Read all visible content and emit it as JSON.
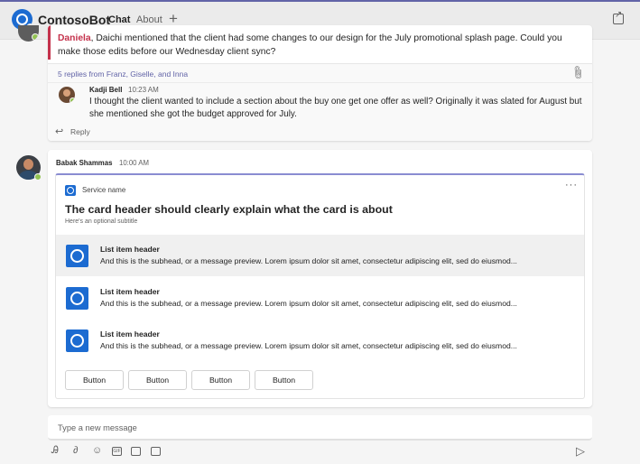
{
  "app": {
    "name": "ContosoBot",
    "tabs": [
      "Chat",
      "About"
    ],
    "active_tab": "Chat",
    "add_tab": "+"
  },
  "previous_message": {
    "mention": "Daniela",
    "text": ", Daichi mentioned that the client had some changes to our design for the July promotional splash page. Could you make those edits before our Wednesday client sync?",
    "replies_summary": "5 replies from Franz, Giselle, and Inna",
    "reply": {
      "author": "Kadji Bell",
      "time": "10:23 AM",
      "text": "I thought the client wanted to include a section about the buy one get one offer as well? Originally it was slated for August but she mentioned she got the budget approved for July."
    },
    "reply_label": "Reply"
  },
  "message": {
    "author": "Babak Shammas",
    "time": "10:00 AM",
    "card": {
      "service_name": "Service name",
      "more": "···",
      "title": "The card header should clearly explain what the card is about",
      "subtitle": "Here's an optional subtitle",
      "items": [
        {
          "header": "List item header",
          "subhead": "And this is the subhead, or a message preview. Lorem ipsum dolor sit amet, consectetur adipiscing elit, sed do eiusmod..."
        },
        {
          "header": "List item header",
          "subhead": "And this is the subhead, or a message preview. Lorem ipsum dolor sit amet, consectetur adipiscing elit, sed do eiusmod..."
        },
        {
          "header": "List item header",
          "subhead": "And this is the subhead, or a message preview. Lorem ipsum dolor sit amet, consectetur adipiscing elit, sed do eiusmod..."
        }
      ],
      "buttons": [
        "Button",
        "Button",
        "Button",
        "Button"
      ]
    }
  },
  "compose": {
    "placeholder": "Type a new message"
  },
  "icons": [
    "format-icon",
    "attach-icon",
    "emoji-icon",
    "gif-icon",
    "sticker-icon",
    "schedule-meeting-icon",
    "send-icon"
  ],
  "colors": {
    "brand": "#6264a7",
    "accent_blue": "#1c6bd1",
    "mention_red": "#c4314b",
    "presence_green": "#92c353"
  }
}
